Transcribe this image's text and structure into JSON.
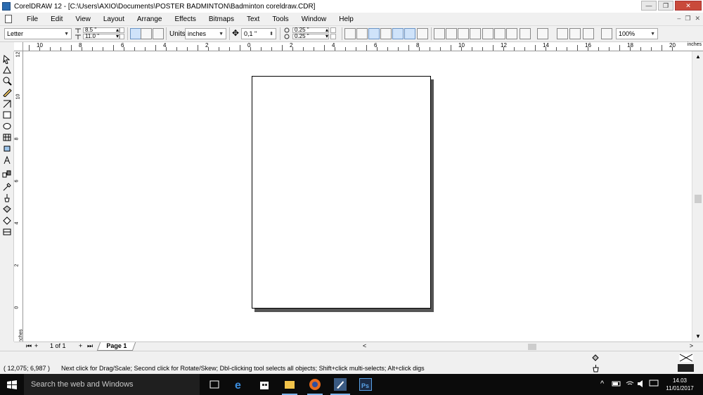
{
  "window": {
    "title": "CorelDRAW 12 - [C:\\Users\\AXIO\\Documents\\POSTER BADMINTON\\Badminton coreldraw.CDR]",
    "min_glyph": "—",
    "restore_glyph": "❐",
    "close_glyph": "✕"
  },
  "menu": {
    "items": [
      "File",
      "Edit",
      "View",
      "Layout",
      "Arrange",
      "Effects",
      "Bitmaps",
      "Text",
      "Tools",
      "Window",
      "Help"
    ],
    "doc_controls": [
      "–",
      "❐",
      "✕"
    ]
  },
  "propbar": {
    "page_size": "Letter",
    "width": "8.5 \"",
    "height": "11.0 \"",
    "units_label": "Units:",
    "units_value": "inches",
    "nudge": "0,1 \"",
    "dup_x": "0.25 \"",
    "dup_y": "0.25 \"",
    "zoom": "100%"
  },
  "ruler": {
    "h_numbers": [
      "10",
      "8",
      "6",
      "4",
      "2",
      "0",
      "2",
      "4",
      "6",
      "8",
      "10",
      "12",
      "14",
      "16",
      "18",
      "20"
    ],
    "h_unit": "inches",
    "v_numbers": [
      "12",
      "10",
      "8",
      "6",
      "4",
      "2",
      "0"
    ],
    "v_unit": "inches"
  },
  "pagenav": {
    "first": "⏮",
    "add_before": "+",
    "count": "1 of 1",
    "add_after": "+",
    "last": "⏭",
    "page_tab": "Page 1",
    "scroll_left": "<",
    "scroll_right": ">"
  },
  "status": {
    "coords": "( 12,075; 6,987 )",
    "message": "Next click for Drag/Scale; Second click for Rotate/Skew; Dbl-clicking tool selects all objects; Shift+click multi-selects; Alt+click digs"
  },
  "taskbar": {
    "search_placeholder": "Search the web and Windows",
    "time": "14.03",
    "date": "11/01/2017",
    "tray_chevron": "^",
    "icons": [
      "windows-logo-icon",
      "task-view-icon",
      "edge-icon",
      "store-icon",
      "file-explorer-icon",
      "firefox-icon",
      "coreldraw-icon",
      "photoshop-icon"
    ]
  },
  "colors": {
    "taskbar_bg": "#0b0b0b",
    "window_chrome": "#f0f0f0",
    "close_button": "#c94a3a",
    "page_shadow": "#555555"
  }
}
